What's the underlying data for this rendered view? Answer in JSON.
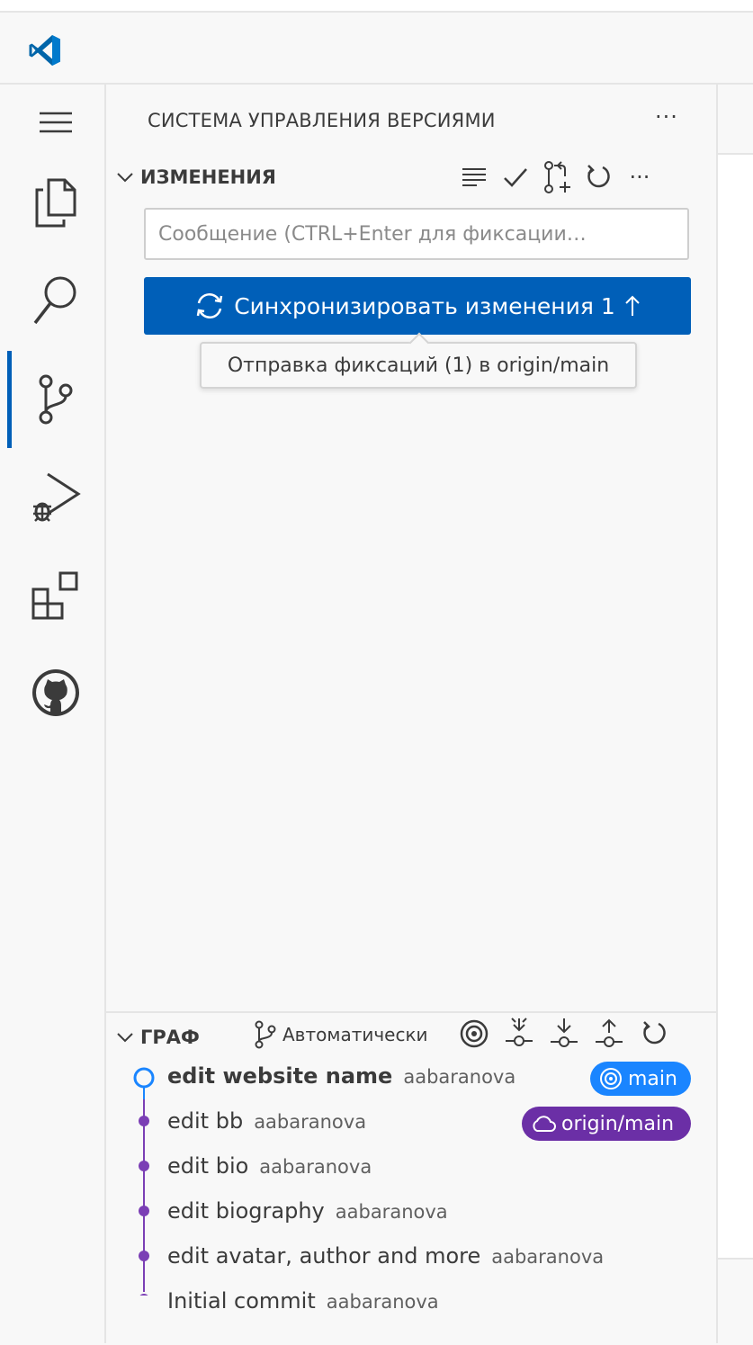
{
  "colors": {
    "accent": "#005fb8",
    "head_branch": "#1a85ff",
    "remote_branch": "#6b2fa6",
    "graph_line": "#7b3fb5"
  },
  "activity_bar": {
    "items": [
      {
        "name": "explorer",
        "icon": "files-icon"
      },
      {
        "name": "search",
        "icon": "search-icon"
      },
      {
        "name": "source-control",
        "icon": "source-control-icon",
        "active": true
      },
      {
        "name": "run-and-debug",
        "icon": "debug-icon"
      },
      {
        "name": "extensions",
        "icon": "extensions-icon"
      },
      {
        "name": "github",
        "icon": "github-icon"
      }
    ]
  },
  "sidebar": {
    "title": "СИСТЕМА УПРАВЛЕНИЯ ВЕРСИЯМИ",
    "more": "···",
    "changes": {
      "label": "ИЗМЕНЕНИЯ",
      "more": "···",
      "message_placeholder": "Сообщение (CTRL+Enter для фиксации…",
      "sync_button": "Синхронизировать изменения 1",
      "tooltip": "Отправка фиксаций (1) в origin/main"
    },
    "graph": {
      "label": "ГРАФ",
      "auto_label": "Автоматически",
      "commits": [
        {
          "message": "edit website name",
          "author": "aabaranova",
          "head": true
        },
        {
          "message": "edit bb",
          "author": "aabaranova"
        },
        {
          "message": "edit bio",
          "author": "aabaranova"
        },
        {
          "message": "edit biography",
          "author": "aabaranova"
        },
        {
          "message": "edit avatar, author and more",
          "author": "aabaranova"
        },
        {
          "message": "Initial commit",
          "author": "aabaranova"
        }
      ],
      "badges": {
        "main": "main",
        "origin": "origin/main"
      }
    }
  }
}
